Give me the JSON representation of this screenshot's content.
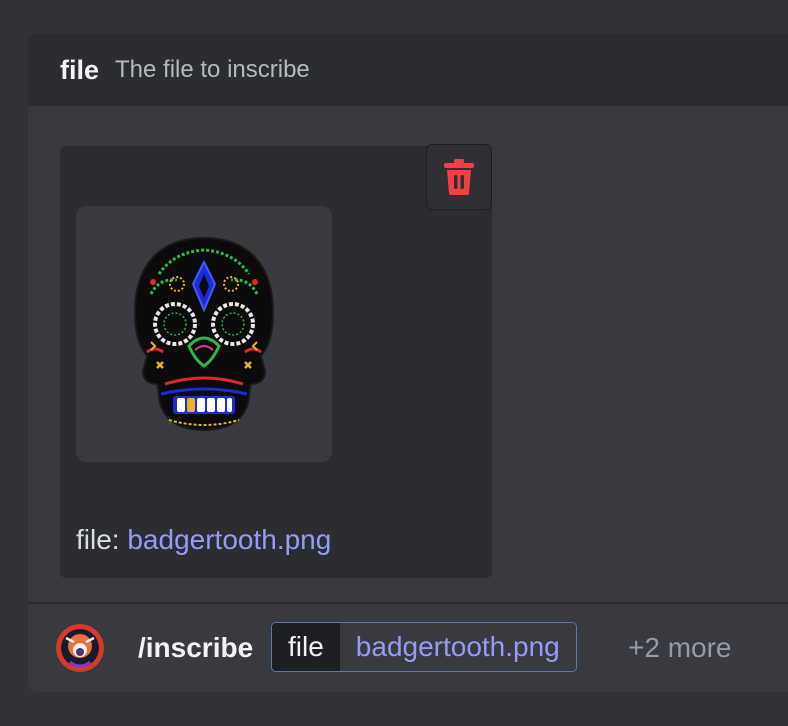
{
  "option": {
    "name": "file",
    "description": "The file to inscribe"
  },
  "attachment": {
    "caption_label": "file:",
    "filename": "badgertooth.png"
  },
  "command": {
    "name": "/inscribe",
    "chip_key": "file",
    "chip_value": "badgertooth.png",
    "more": "+2 more"
  },
  "icons": {
    "delete": "trash-icon",
    "avatar": "bot-avatar"
  },
  "colors": {
    "background": "#313338",
    "panel": "#383a40",
    "header": "#2b2d31",
    "link": "#949cf7",
    "danger": "#f23f43",
    "chip_border": "#5b7aa8"
  }
}
